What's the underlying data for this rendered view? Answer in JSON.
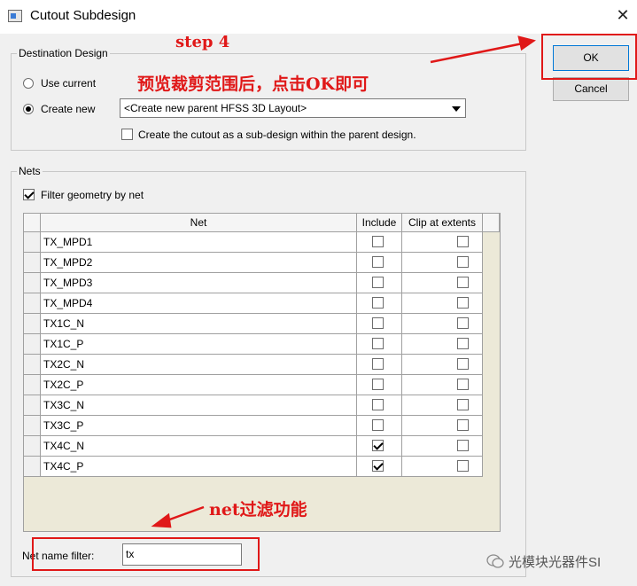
{
  "window": {
    "title": "Cutout Subdesign",
    "close_label": "✕"
  },
  "destination": {
    "legend": "Destination Design",
    "use_current_label": "Use current",
    "create_new_label": "Create new",
    "selected_option": "create_new",
    "combo_value": "<Create new parent HFSS 3D Layout>",
    "subdesign_label": "Create the cutout as a sub-design within the parent design.",
    "subdesign_checked": false
  },
  "buttons": {
    "ok": "OK",
    "cancel": "Cancel"
  },
  "nets": {
    "legend": "Nets",
    "filter_label": "Filter geometry by net",
    "filter_checked": true,
    "columns": {
      "net": "Net",
      "include": "Include",
      "clip": "Clip at extents"
    },
    "rows": [
      {
        "net": "TX_MPD1",
        "include": false,
        "clip": false
      },
      {
        "net": "TX_MPD2",
        "include": false,
        "clip": false
      },
      {
        "net": "TX_MPD3",
        "include": false,
        "clip": false
      },
      {
        "net": "TX_MPD4",
        "include": false,
        "clip": false
      },
      {
        "net": "TX1C_N",
        "include": false,
        "clip": false
      },
      {
        "net": "TX1C_P",
        "include": false,
        "clip": false
      },
      {
        "net": "TX2C_N",
        "include": false,
        "clip": false
      },
      {
        "net": "TX2C_P",
        "include": false,
        "clip": false
      },
      {
        "net": "TX3C_N",
        "include": false,
        "clip": false
      },
      {
        "net": "TX3C_P",
        "include": false,
        "clip": false
      },
      {
        "net": "TX4C_N",
        "include": true,
        "clip": false
      },
      {
        "net": "TX4C_P",
        "include": true,
        "clip": false
      }
    ],
    "name_filter_label": "Net name filter:",
    "name_filter_value": "tx"
  },
  "annotations": {
    "step": "step 4",
    "note": "预览裁剪范围后，点击OK即可",
    "net_filter": "net过滤功能",
    "accent_color": "#e01818"
  },
  "watermark": {
    "text": "光模块光器件SI"
  }
}
